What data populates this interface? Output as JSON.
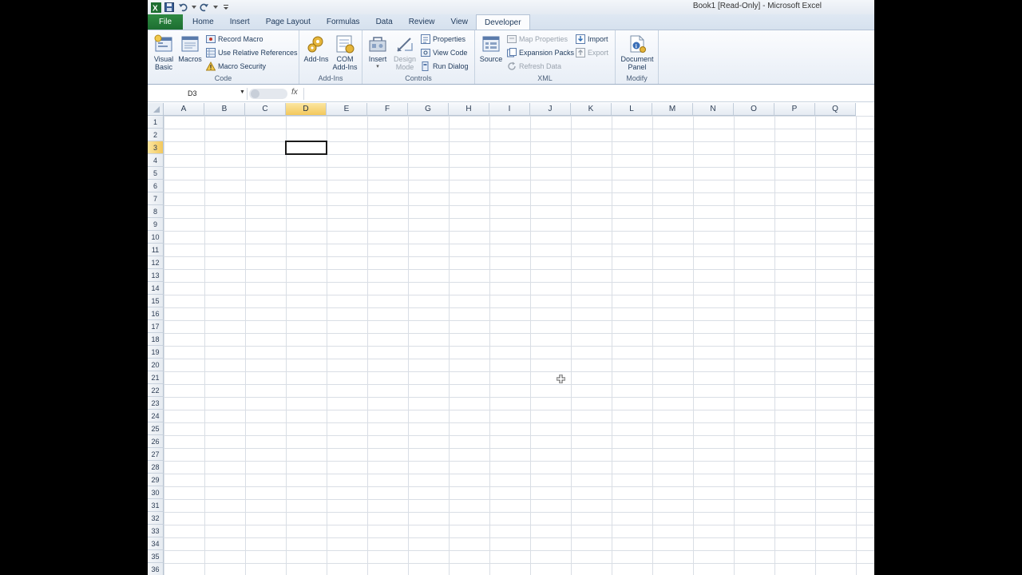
{
  "window": {
    "title": "Book1  [Read-Only]  -  Microsoft Excel"
  },
  "tabs": [
    {
      "label": "File"
    },
    {
      "label": "Home"
    },
    {
      "label": "Insert"
    },
    {
      "label": "Page Layout"
    },
    {
      "label": "Formulas"
    },
    {
      "label": "Data"
    },
    {
      "label": "Review"
    },
    {
      "label": "View"
    },
    {
      "label": "Developer"
    }
  ],
  "ribbon": {
    "code": {
      "label": "Code",
      "visual_basic": "Visual Basic",
      "visual_basic_l1": "Visual",
      "visual_basic_l2": "Basic",
      "macros": "Macros",
      "record_macro": "Record Macro",
      "use_relative": "Use Relative References",
      "macro_security": "Macro Security"
    },
    "addins": {
      "label": "Add-Ins",
      "add_ins": "Add-Ins",
      "com_l1": "COM",
      "com_l2": "Add-Ins"
    },
    "controls": {
      "label": "Controls",
      "insert": "Insert",
      "design_l1": "Design",
      "design_l2": "Mode",
      "properties": "Properties",
      "view_code": "View Code",
      "run_dialog": "Run Dialog"
    },
    "xml": {
      "label": "XML",
      "source": "Source",
      "map_properties": "Map Properties",
      "expansion_packs": "Expansion Packs",
      "refresh_data": "Refresh Data",
      "import": "Import",
      "export": "Export"
    },
    "modify": {
      "label": "Modify",
      "doc_l1": "Document",
      "doc_l2": "Panel"
    }
  },
  "formula_bar": {
    "name_box": "D3",
    "fx": "fx",
    "value": ""
  },
  "sheet": {
    "columns": [
      "A",
      "B",
      "C",
      "D",
      "E",
      "F",
      "G",
      "H",
      "I",
      "J",
      "K",
      "L",
      "M",
      "N",
      "O",
      "P",
      "Q"
    ],
    "rows": [
      "1",
      "2",
      "3",
      "4",
      "5",
      "6",
      "7",
      "8",
      "9",
      "10",
      "11",
      "12",
      "13",
      "14",
      "15",
      "16",
      "17",
      "18",
      "19",
      "20",
      "21",
      "22",
      "23",
      "24",
      "25",
      "26",
      "27",
      "28",
      "29",
      "30",
      "31",
      "32",
      "33",
      "34",
      "35",
      "36"
    ],
    "selected_column": "D",
    "selected_row": "3"
  },
  "colors": {
    "file_tab": "#1d6e31",
    "selection": "#f3c85c",
    "accent": "#1e395b"
  }
}
